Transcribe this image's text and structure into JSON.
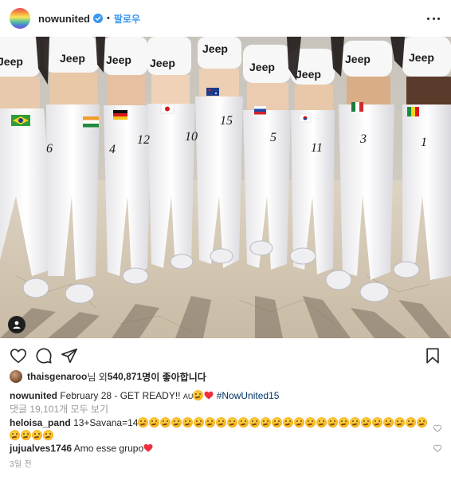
{
  "header": {
    "username": "nowunited",
    "separator": "•",
    "follow_label": "팔로우"
  },
  "photo": {
    "brand_text": "Jeep",
    "jersey_numbers": [
      "6",
      "4",
      "12",
      "10",
      "15",
      "5",
      "11",
      "3",
      "1"
    ]
  },
  "likes": {
    "liker": "thaisgenaroo",
    "text_after_liker": "님 외 ",
    "count": "540,871",
    "suffix": "명이 좋아합니다"
  },
  "caption": {
    "username": "nowunited",
    "text": "February 28 - GET READY!! ",
    "small": "AU",
    "hashtag": "#NowUnited15"
  },
  "view_comments": "댓글 19,101개 모두 보기",
  "comments": [
    {
      "username": "heloisa_pand",
      "text": "13+Savana=14"
    },
    {
      "username": "jujualves1746",
      "text": "Amo esse grupo"
    }
  ],
  "timestamp": "3일 전",
  "colors": {
    "follow": "#3897f0",
    "verified": "#3897f0",
    "hashtag": "#003569",
    "muted": "#999999",
    "heart": "#ed4956"
  }
}
